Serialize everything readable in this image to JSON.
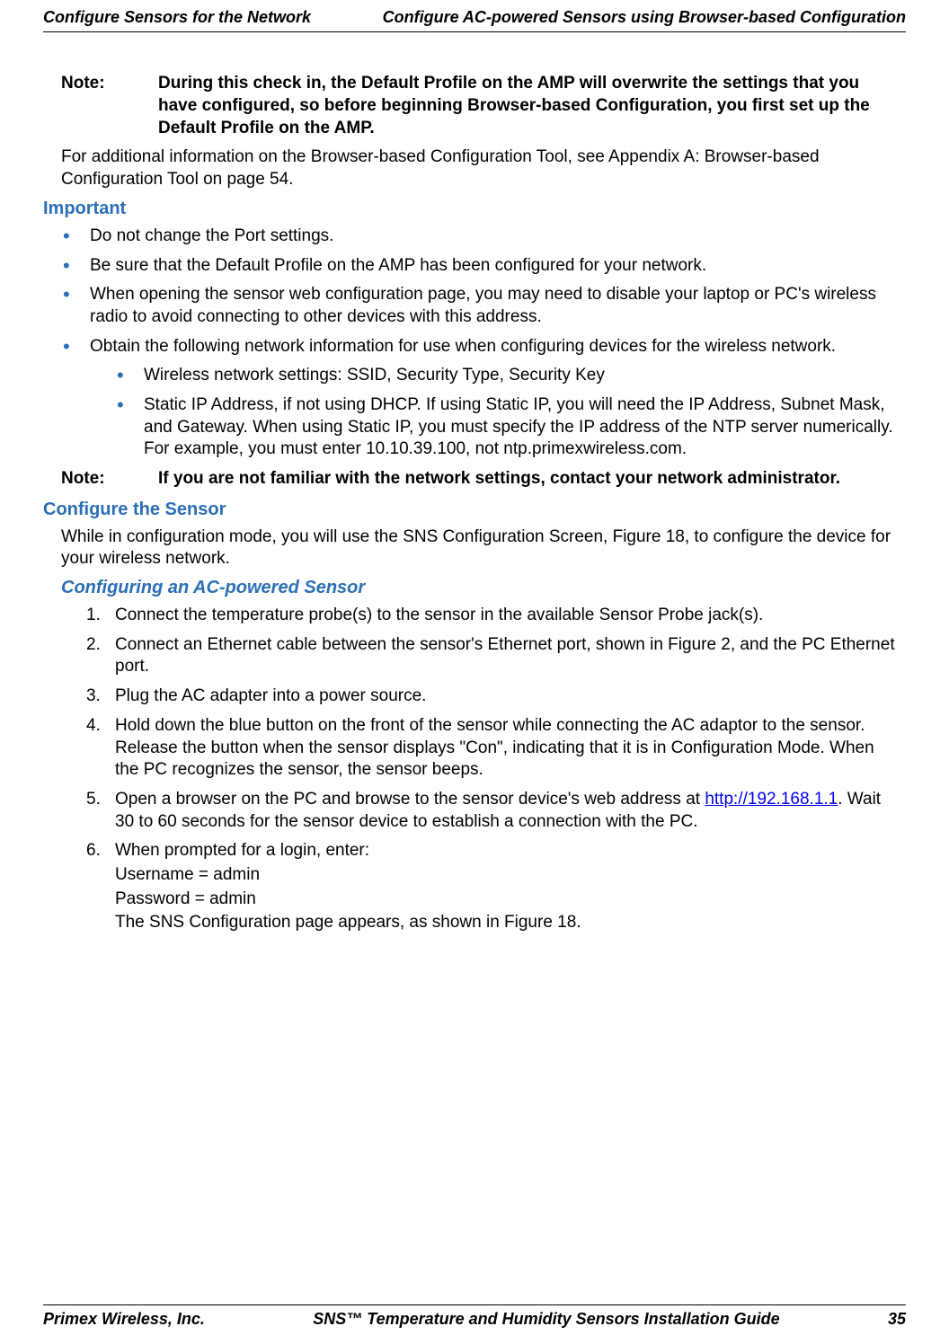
{
  "header": {
    "left": "Configure Sensors for the Network",
    "right": "Configure AC-powered Sensors using Browser-based Configuration"
  },
  "note1": {
    "label": "Note:",
    "text": "During this check in, the Default Profile on the AMP will overwrite the settings that you have configured, so before beginning Browser-based Configuration, you first set up the Default Profile on the AMP."
  },
  "para1": "For additional information on the Browser-based Configuration Tool, see Appendix A: Browser-based Configuration Tool  on page 54.",
  "important_heading": "Important",
  "important_bullets": [
    "Do not change the Port settings.",
    "Be sure that the Default Profile on the AMP has been configured for your network.",
    "When opening the sensor web configuration page, you may need to disable your laptop or PC's wireless radio to avoid connecting to other devices with this address.",
    "Obtain the following network information for use when configuring devices for the wireless network."
  ],
  "nested_bullets": [
    "Wireless network settings: SSID, Security Type, Security Key",
    "Static IP Address, if not using DHCP. If using Static IP, you will need the IP Address, Subnet Mask, and Gateway. When using Static IP, you must specify the IP address of the NTP server numerically. For example, you must enter 10.10.39.100, not ntp.primexwireless.com."
  ],
  "note2": {
    "label": "Note:",
    "text": "If you are not familiar with the network settings, contact your network administrator."
  },
  "configure_heading": "Configure the Sensor",
  "configure_para": "While in configuration mode, you will use the SNS Configuration Screen, Figure 18, to configure the device for your wireless network.",
  "subheading": "Configuring an AC-powered Sensor",
  "steps": {
    "s1": "Connect the temperature probe(s) to the sensor in the available Sensor Probe jack(s).",
    "s2": "Connect an Ethernet cable between the sensor's Ethernet port, shown in Figure 2, and the PC Ethernet port.",
    "s3": "Plug the AC adapter into a power source.",
    "s4": "Hold down the blue button on the front of the sensor while connecting the AC adaptor to the sensor. Release the button when the sensor displays \"Con\", indicating that it is in Configuration Mode. When the PC recognizes the sensor, the sensor beeps.",
    "s5_pre": "Open a browser on the PC and browse to the sensor device's web address at ",
    "s5_link": "http://192.168.1.1",
    "s5_post": ". Wait 30 to 60 seconds for the sensor device to establish a connection with the PC.",
    "s6": "When prompted for a login, enter:",
    "s6_user": "Username = admin",
    "s6_pass": "Password = admin",
    "s6_result": "The SNS Configuration page appears, as shown in Figure 18."
  },
  "footer": {
    "left": "Primex Wireless, Inc.",
    "center": "SNS™ Temperature and Humidity Sensors Installation Guide",
    "right": "35"
  }
}
